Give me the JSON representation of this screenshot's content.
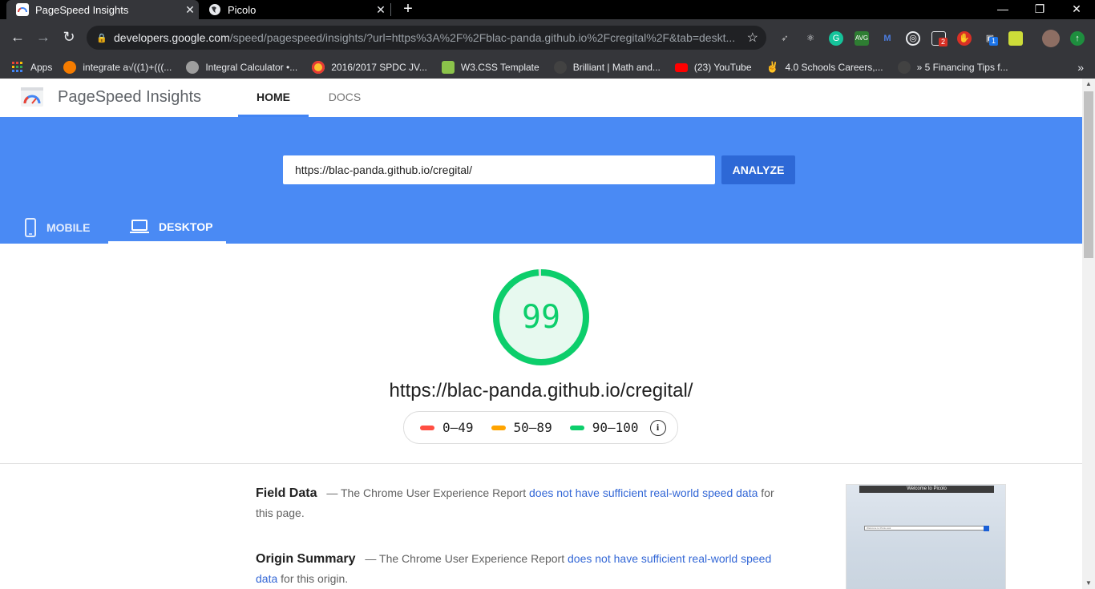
{
  "browser": {
    "tabs": [
      {
        "label": "PageSpeed Insights",
        "active": true,
        "favicon_color": "#ea4335"
      },
      {
        "label": "Picolo",
        "active": false,
        "favicon_color": "#e8eaed"
      }
    ],
    "address": {
      "host": "developers.google.com",
      "path": "/speed/pagespeed/insights/?url=https%3A%2F%2Fblac-panda.github.io%2Fcregital%2F&tab=deskt..."
    },
    "extension_badges": [
      "2",
      "1"
    ],
    "bookmarks": [
      {
        "label": "Apps",
        "icon": "apps-grid-icon",
        "color": "#ea4335"
      },
      {
        "label": "integrate a√((1)+(((...",
        "icon": "gear-sun-icon",
        "color": "#f57c00"
      },
      {
        "label": "Integral Calculator •...",
        "icon": "integral-icon",
        "color": "#9e9e9e"
      },
      {
        "label": "2016/2017 SPDC JV...",
        "icon": "shell-icon",
        "color": "#fbc02d"
      },
      {
        "label": "W3.CSS Template",
        "icon": "chart-icon",
        "color": "#8bc34a"
      },
      {
        "label": "Brilliant | Math and...",
        "icon": "brilliant-icon",
        "color": "#424242"
      },
      {
        "label": "(23) YouTube",
        "icon": "youtube-icon",
        "color": "#ff0000"
      },
      {
        "label": "4.0 Schools Careers,...",
        "icon": "hand-icon",
        "color": "#bdbdbd"
      },
      {
        "label": "» 5 Financing Tips f...",
        "icon": "b-icon",
        "color": "#424242"
      }
    ]
  },
  "app": {
    "title": "PageSpeed Insights",
    "nav": {
      "home": "HOME",
      "docs": "DOCS"
    },
    "url_input_value": "https://blac-panda.github.io/cregital/",
    "analyze_label": "ANALYZE",
    "device_tabs": {
      "mobile": "MOBILE",
      "desktop": "DESKTOP"
    },
    "brand_color": "#4a8af4"
  },
  "report": {
    "score": "99",
    "score_fraction": 0.99,
    "score_color": "#0cce6b",
    "tested_url": "https://blac-panda.github.io/cregital/",
    "legend": [
      {
        "label": "0–49",
        "color": "#ff4e42"
      },
      {
        "label": "50–89",
        "color": "#ffa400"
      },
      {
        "label": "90–100",
        "color": "#0cce6b"
      }
    ],
    "field_data": {
      "heading": "Field Data",
      "dash": "—",
      "before_link": "The Chrome User Experience Report",
      "link": "does not have sufficient real-world speed data",
      "after_link": "for this page."
    },
    "origin_summary": {
      "heading": "Origin Summary",
      "dash": "—",
      "before_link": "The Chrome User Experience Report",
      "link": "does not have sufficient real-world speed data",
      "after_link": "for this origin."
    },
    "screenshot": {
      "title": "Welcome to Picolo",
      "placeholder": "Welcome to Picolo ask"
    }
  }
}
